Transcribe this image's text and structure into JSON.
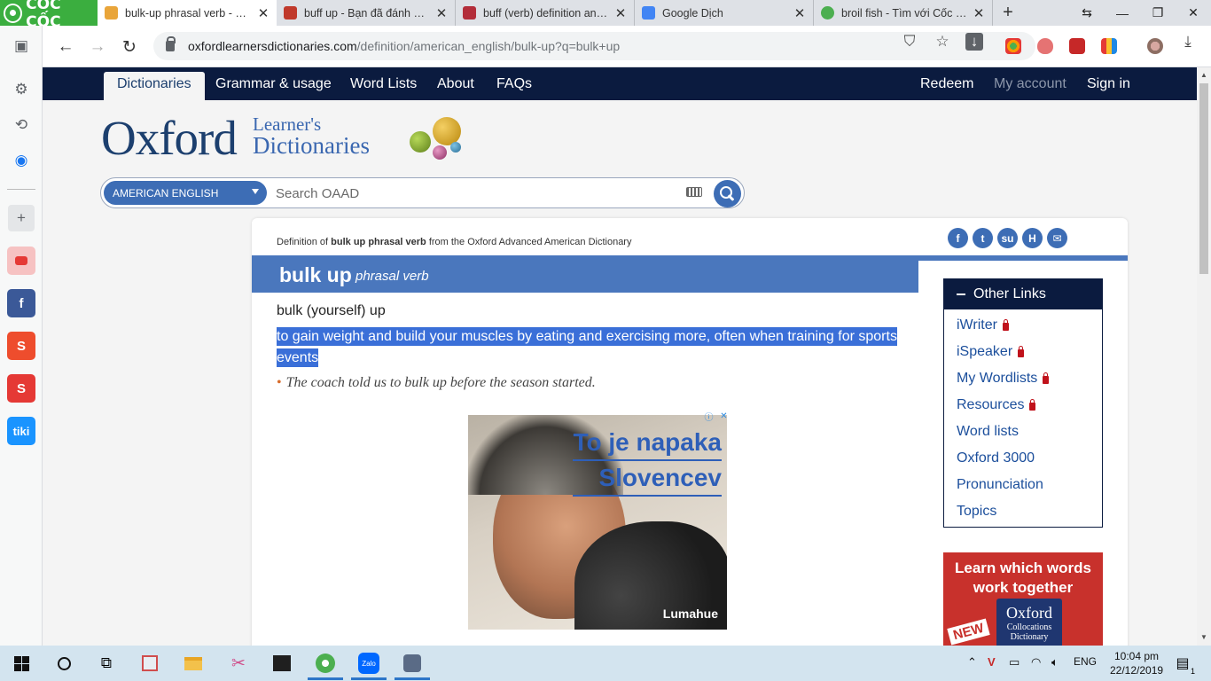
{
  "browser": {
    "brand": "CỐC CỐC",
    "tabs": [
      {
        "title": "bulk-up phrasal verb - Defir",
        "active": true,
        "favicon_color": "#e9a53a"
      },
      {
        "title": "buff up - Bạn đã đánh vần c",
        "active": false,
        "favicon_color": "#c0392b"
      },
      {
        "title": "buff (verb) definition and sy",
        "active": false,
        "favicon_color": "#b32d3a"
      },
      {
        "title": "Google Dịch",
        "active": false,
        "favicon_color": "#4285f4"
      },
      {
        "title": "broil fish - Tìm với Cốc Cốc",
        "active": false,
        "favicon_color": "#4caf50"
      }
    ],
    "url_host": "oxfordlearnersdictionaries.com",
    "url_path": "/definition/american_english/bulk-up?q=bulk+up"
  },
  "site": {
    "nav": {
      "dictionaries": "Dictionaries",
      "grammar": "Grammar & usage",
      "word_lists": "Word Lists",
      "about": "About",
      "faqs": "FAQs",
      "redeem": "Redeem",
      "my_account": "My account",
      "sign_in": "Sign in"
    },
    "logo": {
      "main": "Oxford",
      "line1": "Learner's",
      "line2": "Dictionaries"
    },
    "search": {
      "dictionary": "AMERICAN ENGLISH",
      "placeholder": "Search OAAD"
    },
    "entry": {
      "crumb_prefix": "Definition of",
      "crumb_word": "bulk up phrasal verb",
      "crumb_suffix": "from the Oxford Advanced American Dictionary",
      "headword": "bulk up",
      "pos": "phrasal verb",
      "sense_head": "bulk (yourself) up",
      "definition": "to gain weight and build your muscles by eating and exercising more, often when training for sports events",
      "example": "The coach told us to bulk up before the season started."
    },
    "ad": {
      "line1": "To je napaka",
      "line2": "Slovencev",
      "brand": "Lumahue"
    },
    "other_links": {
      "title": "Other Links",
      "items": [
        {
          "label": "iWriter",
          "locked": true
        },
        {
          "label": "iSpeaker",
          "locked": true
        },
        {
          "label": "My Wordlists",
          "locked": true
        },
        {
          "label": "Resources",
          "locked": true
        },
        {
          "label": "Word lists",
          "locked": false
        },
        {
          "label": "Oxford 3000",
          "locked": false
        },
        {
          "label": "Pronunciation",
          "locked": false
        },
        {
          "label": "Topics",
          "locked": false
        }
      ]
    },
    "promo": {
      "headline": "Learn which words work together",
      "book_title": "Oxford",
      "book_sub": "Collocations Dictionary",
      "badge": "NEW"
    }
  },
  "taskbar": {
    "lang": "ENG",
    "time": "10:04 pm",
    "date": "22/12/2019",
    "notification_count": "1"
  },
  "colors": {
    "navy": "#0b1b3f",
    "oxford_blue": "#4a77bd",
    "link_blue": "#1c4f9c",
    "selection": "#3a6fd8",
    "coccoc_green": "#3bae3f"
  }
}
